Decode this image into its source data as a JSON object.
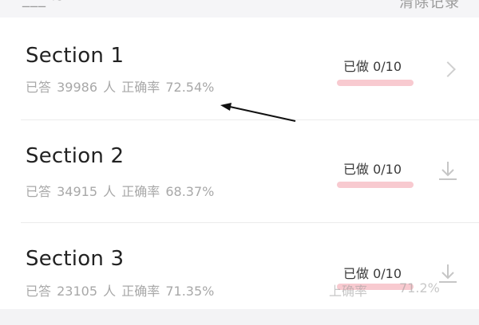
{
  "header": {
    "left_text": "___ ~",
    "right_text": "清除记录"
  },
  "sections": [
    {
      "title": "Section 1",
      "answered_label": "已答",
      "answered_count": "39986",
      "people_unit": "人",
      "accuracy_label": "正确率",
      "accuracy": "72.54%",
      "progress": "已做 0/10",
      "trailing_icon": "chevron-right-icon"
    },
    {
      "title": "Section 2",
      "answered_label": "已答",
      "answered_count": "34915",
      "people_unit": "人",
      "accuracy_label": "正确率",
      "accuracy": "68.37%",
      "progress": "已做 0/10",
      "trailing_icon": "download-icon"
    },
    {
      "title": "Section 3",
      "answered_label": "已答",
      "answered_count": "23105",
      "people_unit": "人",
      "accuracy_label": "正确率",
      "accuracy": "71.35%",
      "progress": "已做 0/10",
      "trailing_icon": "download-icon"
    }
  ],
  "overlay": {
    "line1": "正确率 71.2%",
    "line2": "上确率",
    "line3": "71.2%"
  },
  "annotation": {
    "arrow_icon": "annotation-arrow"
  },
  "colors": {
    "accent_underline": "#f7c4cb",
    "meta_text": "#a8a8a8",
    "title_text": "#222222",
    "background": "#f3f3f5"
  }
}
